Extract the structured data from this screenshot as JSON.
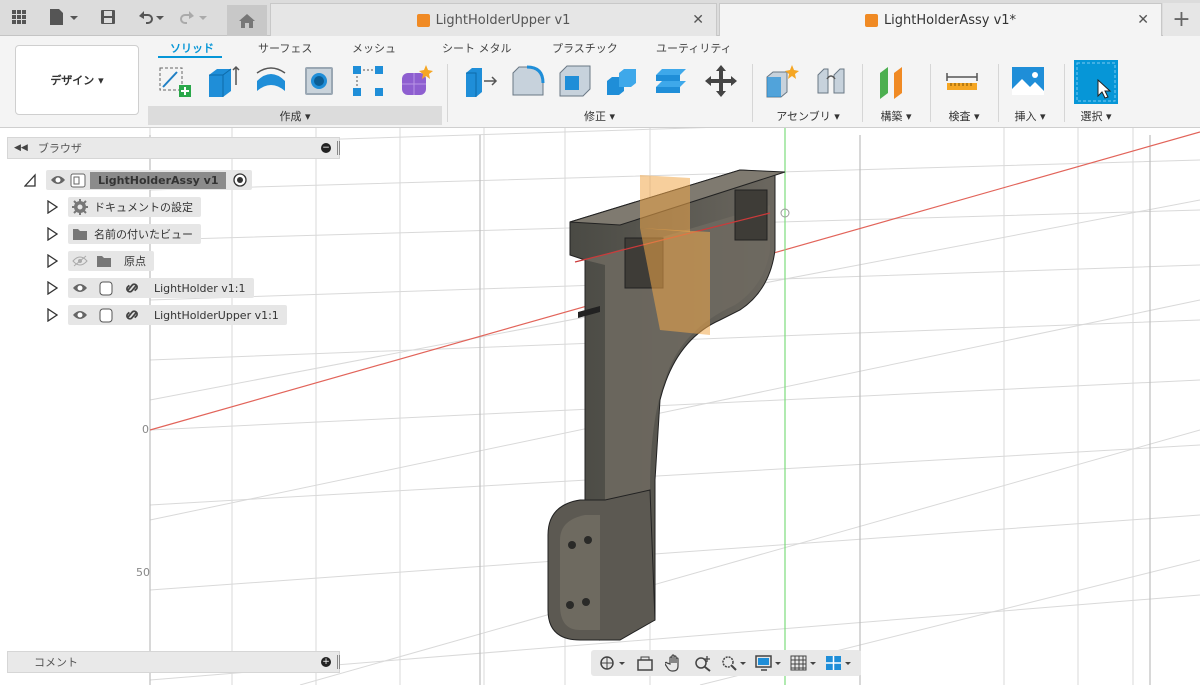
{
  "titlebar": {
    "tabs": [
      {
        "label": "LightHolderUpper v1",
        "active": false
      },
      {
        "label": "LightHolderAssy v1*",
        "active": true
      }
    ],
    "close_glyph": "✕",
    "new_tab_glyph": "+"
  },
  "toolbar": {
    "workspace_button": "デザイン ▾",
    "workspace_tabs": [
      "ソリッド",
      "サーフェス",
      "メッシュ",
      "シート メタル",
      "プラスチック",
      "ユーティリティ"
    ],
    "groups": {
      "create": "作成 ▾",
      "modify": "修正 ▾",
      "assemble": "アセンブリ ▾",
      "construct": "構築 ▾",
      "inspect": "検査 ▾",
      "insert": "挿入 ▾",
      "select": "選択 ▾"
    }
  },
  "browser": {
    "title": "ブラウザ",
    "root": "LightHolderAssy v1",
    "items": [
      {
        "label": "ドキュメントの設定",
        "icon": "gear-icon"
      },
      {
        "label": "名前の付いたビュー",
        "icon": "folder-icon"
      },
      {
        "label": "原点",
        "icon": "folder-icon"
      },
      {
        "label": "LightHolder v1:1",
        "icon": "component-icon"
      },
      {
        "label": "LightHolderUpper v1:1",
        "icon": "component-icon"
      }
    ]
  },
  "comments": {
    "title": "コメント"
  },
  "viewport": {
    "axis_labels": [
      "0",
      "50"
    ]
  },
  "colors": {
    "accent": "#0696d7",
    "tab_cube": "#f08a24",
    "x_axis": "#e2645a",
    "y_axis": "#7ddc7d"
  }
}
